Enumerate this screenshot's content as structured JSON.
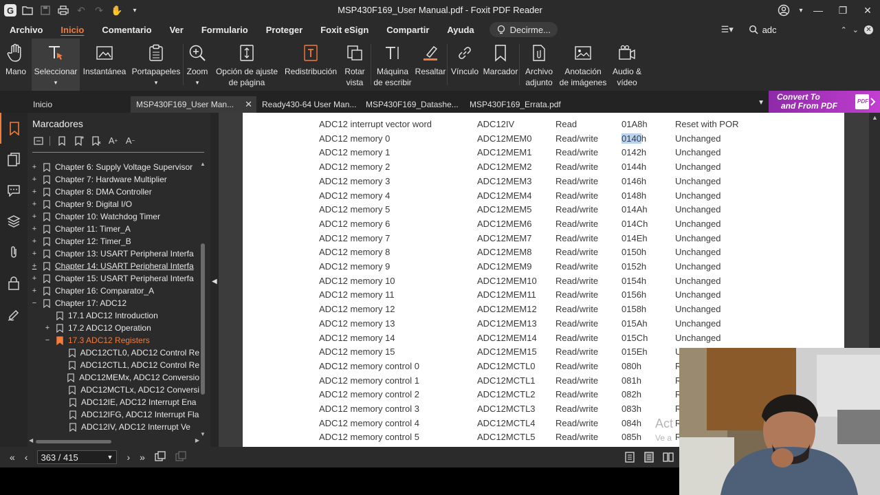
{
  "window": {
    "title": "MSP430F169_User Manual.pdf - Foxit PDF Reader"
  },
  "menu": {
    "items": [
      "Archivo",
      "Inicio",
      "Comentario",
      "Ver",
      "Formulario",
      "Proteger",
      "Foxit eSign",
      "Compartir",
      "Ayuda"
    ],
    "active": "Inicio",
    "tell_me": "Decirme...",
    "search_value": "adc"
  },
  "ribbon": {
    "tools": [
      {
        "label": "Mano",
        "icon": "hand-icon"
      },
      {
        "label": "Seleccionar",
        "icon": "select-text-icon"
      },
      {
        "label": "Instantánea",
        "icon": "snapshot-icon"
      },
      {
        "label": "Portapapeles",
        "icon": "clipboard-icon"
      },
      {
        "label": "Zoom",
        "icon": "zoom-icon"
      },
      {
        "label": "Opción de ajuste de página",
        "icon": "page-fit-icon"
      },
      {
        "label": "Redistribución",
        "icon": "reflow-icon"
      },
      {
        "label": "Rotar vista",
        "icon": "rotate-icon"
      },
      {
        "label": "Máquina de escribir",
        "icon": "typewriter-icon"
      },
      {
        "label": "Resaltar",
        "icon": "highlight-icon"
      },
      {
        "label": "Vínculo",
        "icon": "link-icon"
      },
      {
        "label": "Marcador",
        "icon": "bookmark-icon"
      },
      {
        "label": "Archivo adjunto",
        "icon": "attachment-icon"
      },
      {
        "label": "Anotación de imágenes",
        "icon": "image-annotation-icon"
      },
      {
        "label": "Audio & vídeo",
        "icon": "audio-video-icon"
      }
    ]
  },
  "tabs": {
    "home": "Inicio",
    "items": [
      "MSP430F169_User Man...",
      "Ready430-64 User Man...",
      "MSP430F169_Datashe...",
      "MSP430F169_Errata.pdf"
    ],
    "convert_line1": "Convert To",
    "convert_line2": "and From PDF"
  },
  "bookmarks": {
    "title": "Marcadores",
    "items": [
      {
        "label": "Chapter 6: Supply Voltage Supervisor",
        "level": 0,
        "toggle": "+"
      },
      {
        "label": "Chapter 7: Hardware Multiplier",
        "level": 0,
        "toggle": "+"
      },
      {
        "label": "Chapter 8: DMA Controller",
        "level": 0,
        "toggle": "+"
      },
      {
        "label": "Chapter 9: Digital I/O",
        "level": 0,
        "toggle": "+"
      },
      {
        "label": "Chapter 10: Watchdog Timer",
        "level": 0,
        "toggle": "+"
      },
      {
        "label": "Chapter 11: Timer_A",
        "level": 0,
        "toggle": "+"
      },
      {
        "label": "Chapter 12: Timer_B",
        "level": 0,
        "toggle": "+"
      },
      {
        "label": "Chapter 13: USART Peripheral Interfa",
        "level": 0,
        "toggle": "+"
      },
      {
        "label": "Chapter 14: USART Peripheral Interfa",
        "level": 0,
        "toggle": "+"
      },
      {
        "label": "Chapter 15: USART Peripheral Interfa",
        "level": 0,
        "toggle": "+"
      },
      {
        "label": "Chapter 16: Comparator_A",
        "level": 0,
        "toggle": "+"
      },
      {
        "label": "Chapter 17: ADC12",
        "level": 0,
        "toggle": "−"
      },
      {
        "label": "17.1 ADC12 Introduction",
        "level": 1,
        "toggle": ""
      },
      {
        "label": "17.2 ADC12 Operation",
        "level": 1,
        "toggle": "+"
      },
      {
        "label": "17.3 ADC12 Registers",
        "level": 1,
        "toggle": "−"
      },
      {
        "label": "ADC12CTL0, ADC12 Control Re",
        "level": 2,
        "toggle": ""
      },
      {
        "label": "ADC12CTL1, ADC12 Control Re",
        "level": 2,
        "toggle": ""
      },
      {
        "label": "ADC12MEMx, ADC12 Conversio",
        "level": 2,
        "toggle": ""
      },
      {
        "label": "ADC12MCTLx, ADC12 Conversi",
        "level": 2,
        "toggle": ""
      },
      {
        "label": "ADC12IE, ADC12 Interrupt Ena",
        "level": 2,
        "toggle": ""
      },
      {
        "label": "ADC12IFG, ADC12 Interrupt Fla",
        "level": 2,
        "toggle": ""
      },
      {
        "label": "ADC12IV, ADC12 Interrupt Ve",
        "level": 2,
        "toggle": ""
      }
    ],
    "current": "17.3 ADC12 Registers"
  },
  "registers": [
    {
      "name": "ADC12 interrupt vector word",
      "short": "ADC12IV",
      "type": "Read",
      "addr": "01A8h",
      "reset": "Reset with POR"
    },
    {
      "name": "ADC12 memory 0",
      "short": "ADC12MEM0",
      "type": "Read/write",
      "addr": "0140h",
      "reset": "Unchanged"
    },
    {
      "name": "ADC12 memory 1",
      "short": "ADC12MEM1",
      "type": "Read/write",
      "addr": "0142h",
      "reset": "Unchanged"
    },
    {
      "name": "ADC12 memory 2",
      "short": "ADC12MEM2",
      "type": "Read/write",
      "addr": "0144h",
      "reset": "Unchanged"
    },
    {
      "name": "ADC12 memory 3",
      "short": "ADC12MEM3",
      "type": "Read/write",
      "addr": "0146h",
      "reset": "Unchanged"
    },
    {
      "name": "ADC12 memory 4",
      "short": "ADC12MEM4",
      "type": "Read/write",
      "addr": "0148h",
      "reset": "Unchanged"
    },
    {
      "name": "ADC12 memory 5",
      "short": "ADC12MEM5",
      "type": "Read/write",
      "addr": "014Ah",
      "reset": "Unchanged"
    },
    {
      "name": "ADC12 memory 6",
      "short": "ADC12MEM6",
      "type": "Read/write",
      "addr": "014Ch",
      "reset": "Unchanged"
    },
    {
      "name": "ADC12 memory 7",
      "short": "ADC12MEM7",
      "type": "Read/write",
      "addr": "014Eh",
      "reset": "Unchanged"
    },
    {
      "name": "ADC12 memory 8",
      "short": "ADC12MEM8",
      "type": "Read/write",
      "addr": "0150h",
      "reset": "Unchanged"
    },
    {
      "name": "ADC12 memory 9",
      "short": "ADC12MEM9",
      "type": "Read/write",
      "addr": "0152h",
      "reset": "Unchanged"
    },
    {
      "name": "ADC12 memory 10",
      "short": "ADC12MEM10",
      "type": "Read/write",
      "addr": "0154h",
      "reset": "Unchanged"
    },
    {
      "name": "ADC12 memory 11",
      "short": "ADC12MEM11",
      "type": "Read/write",
      "addr": "0156h",
      "reset": "Unchanged"
    },
    {
      "name": "ADC12 memory 12",
      "short": "ADC12MEM12",
      "type": "Read/write",
      "addr": "0158h",
      "reset": "Unchanged"
    },
    {
      "name": "ADC12 memory 13",
      "short": "ADC12MEM13",
      "type": "Read/write",
      "addr": "015Ah",
      "reset": "Unchanged"
    },
    {
      "name": "ADC12 memory 14",
      "short": "ADC12MEM14",
      "type": "Read/write",
      "addr": "015Ch",
      "reset": "Unchanged"
    },
    {
      "name": "ADC12 memory 15",
      "short": "ADC12MEM15",
      "type": "Read/write",
      "addr": "015Eh",
      "reset": "U"
    },
    {
      "name": "ADC12 memory control 0",
      "short": "ADC12MCTL0",
      "type": "Read/write",
      "addr": "080h",
      "reset": "R"
    },
    {
      "name": "ADC12 memory control 1",
      "short": "ADC12MCTL1",
      "type": "Read/write",
      "addr": "081h",
      "reset": "R"
    },
    {
      "name": "ADC12 memory control 2",
      "short": "ADC12MCTL2",
      "type": "Read/write",
      "addr": "082h",
      "reset": "R"
    },
    {
      "name": "ADC12 memory control 3",
      "short": "ADC12MCTL3",
      "type": "Read/write",
      "addr": "083h",
      "reset": "R"
    },
    {
      "name": "ADC12 memory control 4",
      "short": "ADC12MCTL4",
      "type": "Read/write",
      "addr": "084h",
      "reset": "R"
    },
    {
      "name": "ADC12 memory control 5",
      "short": "ADC12MCTL5",
      "type": "Read/write",
      "addr": "085h",
      "reset": "R"
    }
  ],
  "search_highlight": "0140",
  "watermark": "Act",
  "watermark_sub": "Ve a",
  "status": {
    "page": "363 / 415"
  },
  "colors": {
    "accent": "#f47b3a",
    "convert_banner": "#b23ac6",
    "highlight": "#b9d3ef"
  }
}
